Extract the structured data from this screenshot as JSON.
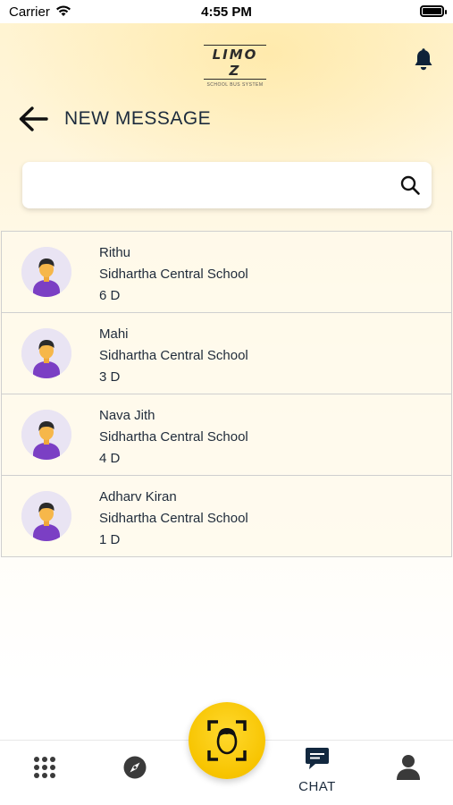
{
  "status_bar": {
    "carrier": "Carrier",
    "time": "4:55 PM"
  },
  "header": {
    "logo_text": "LIMO Z",
    "logo_subtitle": "SCHOOL BUS SYSTEM",
    "title": "NEW MESSAGE"
  },
  "search": {
    "value": "",
    "placeholder": ""
  },
  "contacts": [
    {
      "name": "Rithu",
      "school": "Sidhartha Central School",
      "class": "6 D"
    },
    {
      "name": "Mahi",
      "school": "Sidhartha Central School",
      "class": "3 D"
    },
    {
      "name": "Nava Jith",
      "school": "Sidhartha Central School",
      "class": "4 D"
    },
    {
      "name": "Adharv Kiran",
      "school": "Sidhartha Central School",
      "class": "1 D"
    }
  ],
  "bottom_nav": {
    "chat_label": "CHAT"
  },
  "colors": {
    "accent_yellow": "#f7c400",
    "text_dark": "#1c2b3d",
    "avatar_shirt": "#7b3fc4"
  }
}
